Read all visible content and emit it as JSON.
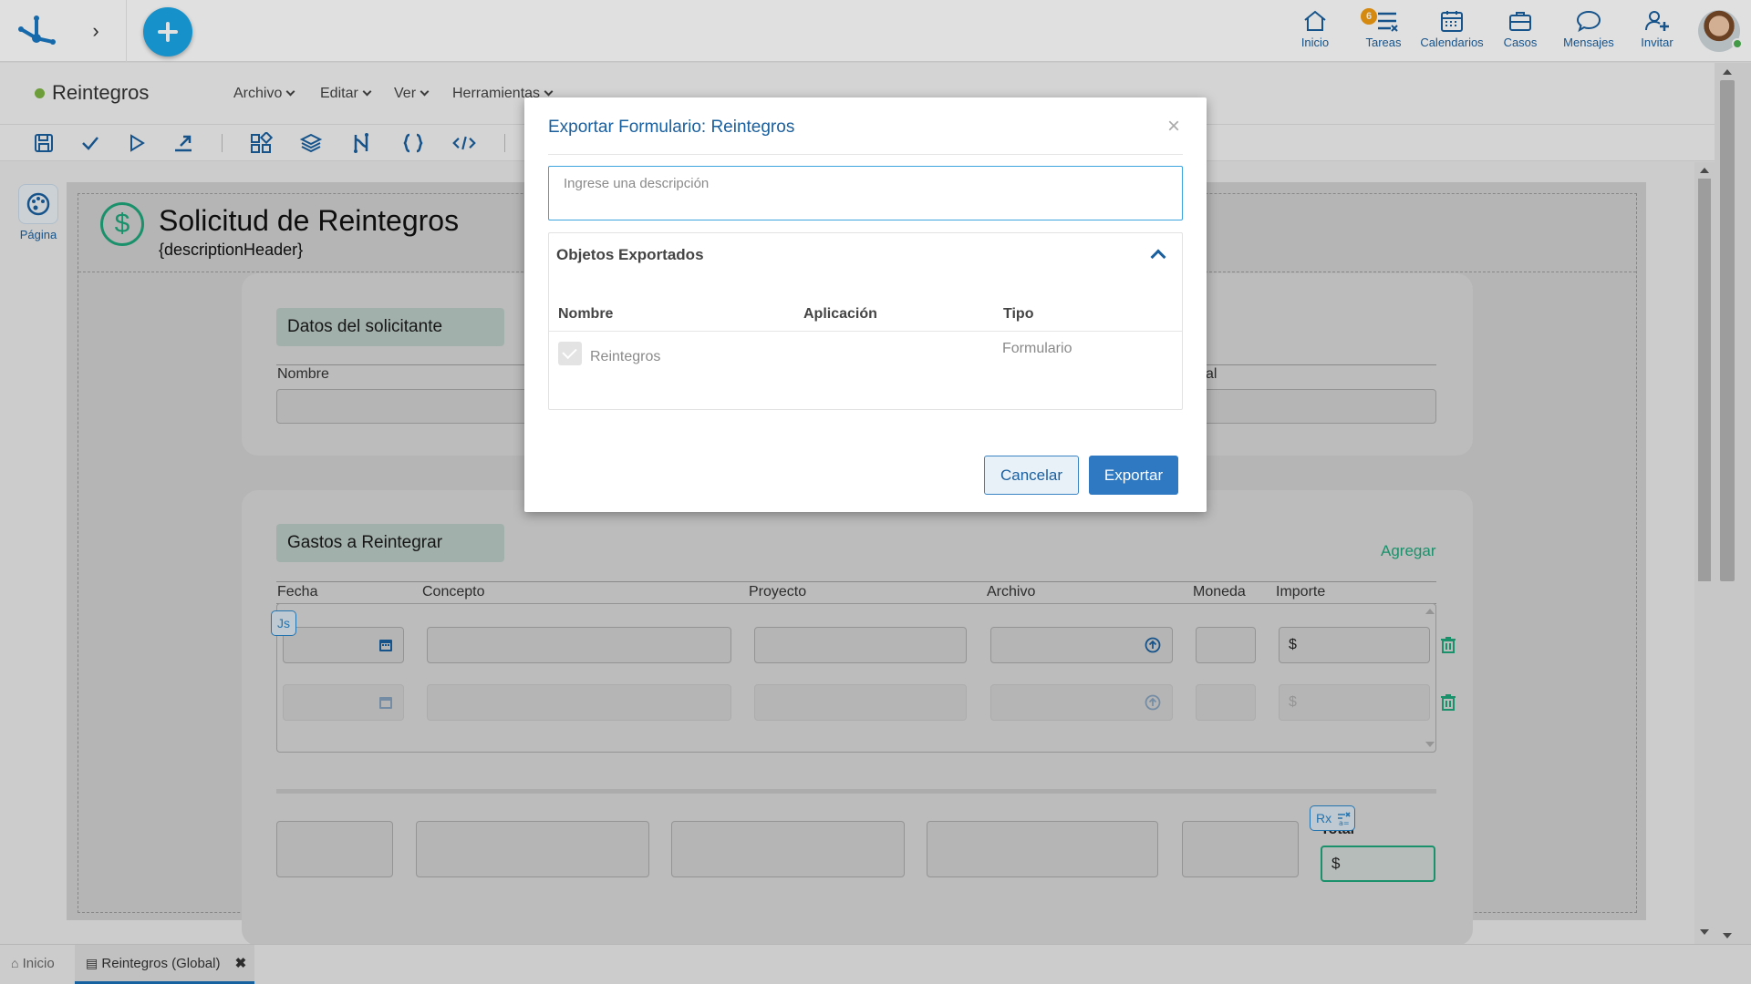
{
  "topbar": {
    "nav": [
      {
        "id": "inicio",
        "label": "Inicio",
        "icon": "home-icon"
      },
      {
        "id": "tareas",
        "label": "Tareas",
        "icon": "tasks-icon",
        "badge": "6"
      },
      {
        "id": "calendarios",
        "label": "Calendarios",
        "icon": "calendar-icon"
      },
      {
        "id": "casos",
        "label": "Casos",
        "icon": "briefcase-icon"
      },
      {
        "id": "mensajes",
        "label": "Mensajes",
        "icon": "chat-icon"
      },
      {
        "id": "invitar",
        "label": "Invitar",
        "icon": "add-user-icon"
      }
    ]
  },
  "designer": {
    "title": "Reintegros",
    "menus": [
      "Archivo",
      "Editar",
      "Ver",
      "Herramientas"
    ],
    "palette_label": "Página"
  },
  "form": {
    "title": "Solicitud de Reintegros",
    "subtitle": "{descriptionHeader}",
    "section1": {
      "label": "Datos del solicitante",
      "field_label": "Nombre",
      "field_label_right": "al"
    },
    "section2": {
      "label": "Gastos a Reintegrar",
      "add_label": "Agregar",
      "columns": [
        "Fecha",
        "Concepto",
        "Proyecto",
        "Archivo",
        "Moneda",
        "Importe"
      ],
      "currency_symbol": "$",
      "js_tag": "Js",
      "rx_tag": "Rx",
      "total_label": "Total",
      "total_value": "$"
    }
  },
  "bottom_tabs": [
    {
      "label": "Inicio"
    },
    {
      "label": "Reintegros (Global)"
    }
  ],
  "modal": {
    "title": "Exportar Formulario: Reintegros",
    "description_placeholder": "Ingrese una descripción",
    "panel_title": "Objetos Exportados",
    "columns": [
      "Nombre",
      "Aplicación",
      "Tipo"
    ],
    "rows": [
      {
        "name": "Reintegros",
        "application": "",
        "type": "Formulario"
      }
    ],
    "cancel_label": "Cancelar",
    "export_label": "Exportar"
  },
  "colors": {
    "accent": "#2f78c2",
    "brand_blue": "#1aa6e6",
    "green": "#1fa67a",
    "badge": "#f39c12"
  }
}
